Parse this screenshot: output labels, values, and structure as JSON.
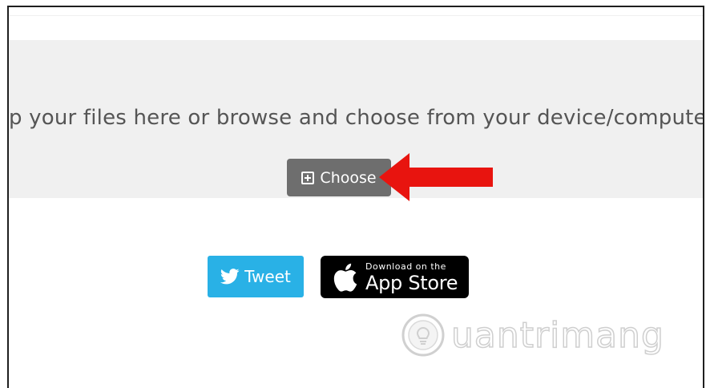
{
  "dropzone": {
    "instruction": "p your files here or browse and choose from your device/computer",
    "choose_label": "Choose"
  },
  "social": {
    "tweet_label": "Tweet",
    "appstore_small": "Download on the",
    "appstore_big": "App Store"
  },
  "watermark": {
    "text": "uantrimang"
  },
  "colors": {
    "dropzone_bg": "#f0f0f0",
    "choose_bg": "#6e6e6e",
    "arrow": "#e8140f",
    "tweet_bg": "#29b1e6",
    "appstore_bg": "#000000"
  },
  "icons": {
    "choose": "plus-square-icon",
    "tweet": "twitter-bird-icon",
    "appstore": "apple-icon",
    "watermark": "lightbulb-icon"
  }
}
